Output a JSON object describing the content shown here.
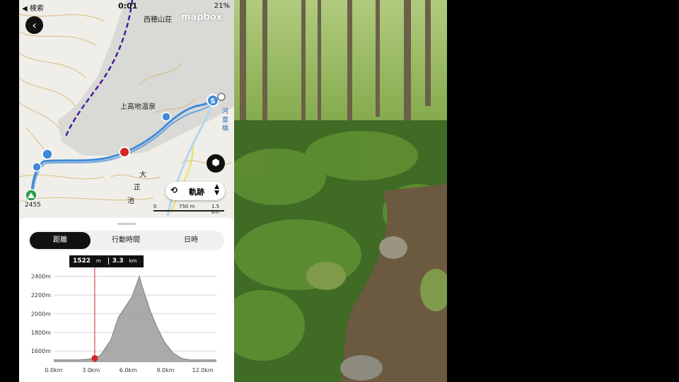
{
  "status_bar": {
    "back_app": "◀ 検索",
    "time": "0:01",
    "battery": "21%"
  },
  "map": {
    "attribution": "mapbox",
    "labels": {
      "hut_nishihotaka": "西穂山荘",
      "onsen": "上高地温泉",
      "taisho_ike_1": "大",
      "taisho_ike_2": "正",
      "taisho_ike_3": "池",
      "elevation": "2455",
      "river_1": "河",
      "river_2": "童",
      "river_3": "橋",
      "start_marker": "S"
    },
    "track_selector": {
      "label": "軌跡",
      "icon": "route-icon"
    },
    "scale": {
      "zero": "0",
      "mid": "750 m",
      "end": "1.5 km"
    }
  },
  "panel": {
    "tabs": [
      {
        "label": "距離",
        "active": true
      },
      {
        "label": "行動時間",
        "active": false
      },
      {
        "label": "日時",
        "active": false
      }
    ],
    "tooltip": {
      "elevation": "1522",
      "elevation_unit": "m",
      "distance": "3.3",
      "distance_unit": "km"
    }
  },
  "chart_data": {
    "type": "area",
    "xlabel": "",
    "ylabel": "",
    "xlim": [
      0,
      13.1
    ],
    "ylim": [
      1480,
      2480
    ],
    "xticks": [
      "0.0km",
      "3.0km",
      "6.0km",
      "9.0km",
      "12.0km"
    ],
    "xtick_values": [
      0,
      3,
      6,
      9,
      12
    ],
    "yticks": [
      "1600m",
      "1800m",
      "2000m",
      "2200m",
      "2400m"
    ],
    "ytick_values": [
      1600,
      1800,
      2000,
      2200,
      2400
    ],
    "cursor": {
      "x": 3.3,
      "y": 1522
    },
    "series": [
      {
        "x": [
          0,
          1,
          2,
          2.7,
          3.3,
          3.8,
          4.6,
          5.2,
          5.7,
          6.0,
          6.3,
          6.6,
          6.9,
          7.1,
          7.4,
          7.8,
          8.3,
          8.9,
          9.6,
          10.3,
          11,
          12,
          13.1
        ],
        "y": [
          1505,
          1505,
          1505,
          1512,
          1522,
          1560,
          1720,
          1960,
          2060,
          2120,
          2180,
          2290,
          2400,
          2300,
          2180,
          2020,
          1860,
          1700,
          1580,
          1520,
          1505,
          1505,
          1505
        ]
      }
    ]
  },
  "colors": {
    "track": "#3f8ad8",
    "trail_purple": "#4a1a9e",
    "marker_red": "#d1252a",
    "accent_dark": "#111111"
  }
}
